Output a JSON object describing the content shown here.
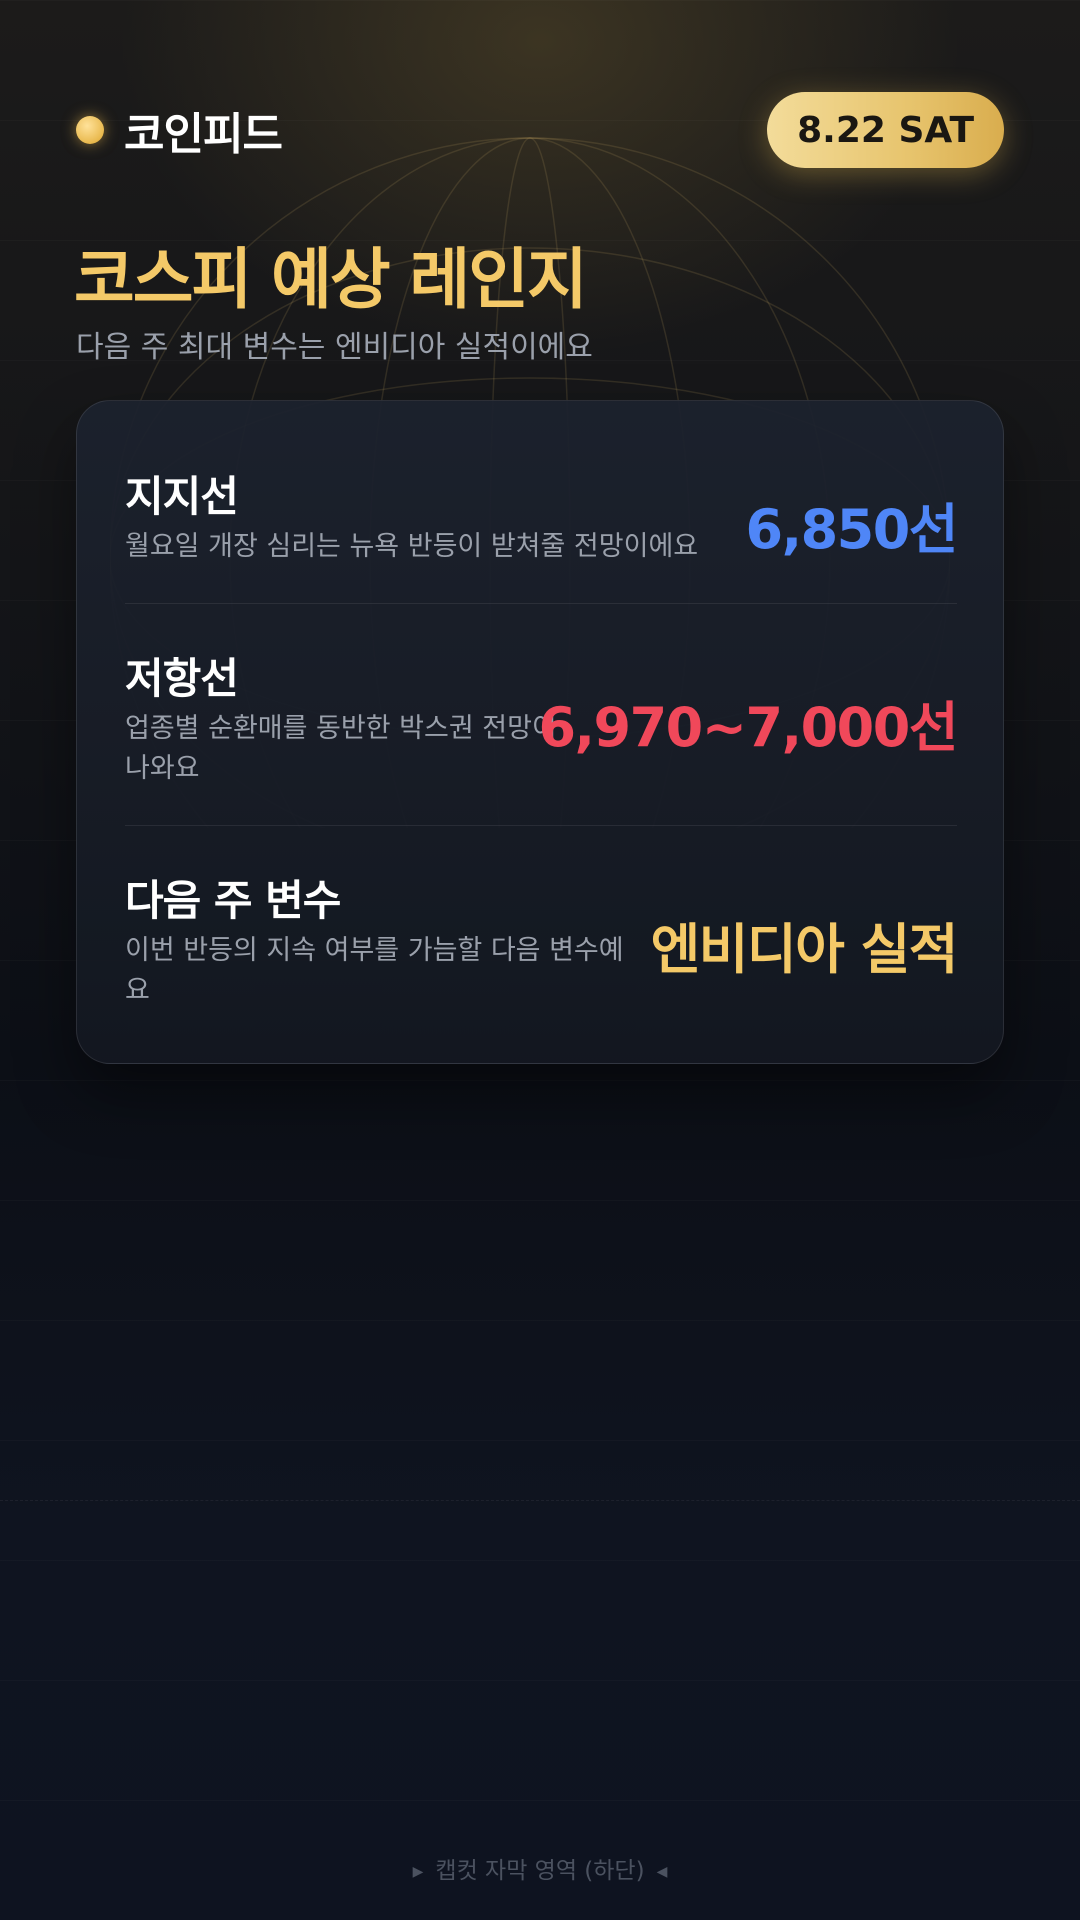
{
  "header": {
    "brand_name": "코인피드",
    "date": "8.22 SAT"
  },
  "title": "코스피 예상 레인지",
  "subtitle": "다음 주 최대 변수는 엔비디아 실적이에요",
  "rows": [
    {
      "label": "지지선",
      "description": "월요일 개장 심리는 뉴욕 반등이 받쳐줄 전망이에요",
      "value": "6,850선",
      "value_color": "#4f86f7"
    },
    {
      "label": "저항선",
      "description_line1": "업종별 순환매를 동반한 박스권 전망이",
      "description_line2": "나와요",
      "value": "6,970~7,000선",
      "value_color": "#f0485a"
    },
    {
      "label": "다음 주 변수",
      "description_line1": "이번 반등의 지속 여부를 가늠할 다음 변수예",
      "description_line2": "요",
      "value": "엔비디아 실적",
      "value_color": "#f4c968"
    }
  ],
  "caption": "캡컷 자막 영역 (하단)",
  "colors": {
    "accent_gold": "#f4c968",
    "support_blue": "#4f86f7",
    "resistance_red": "#f0485a"
  }
}
